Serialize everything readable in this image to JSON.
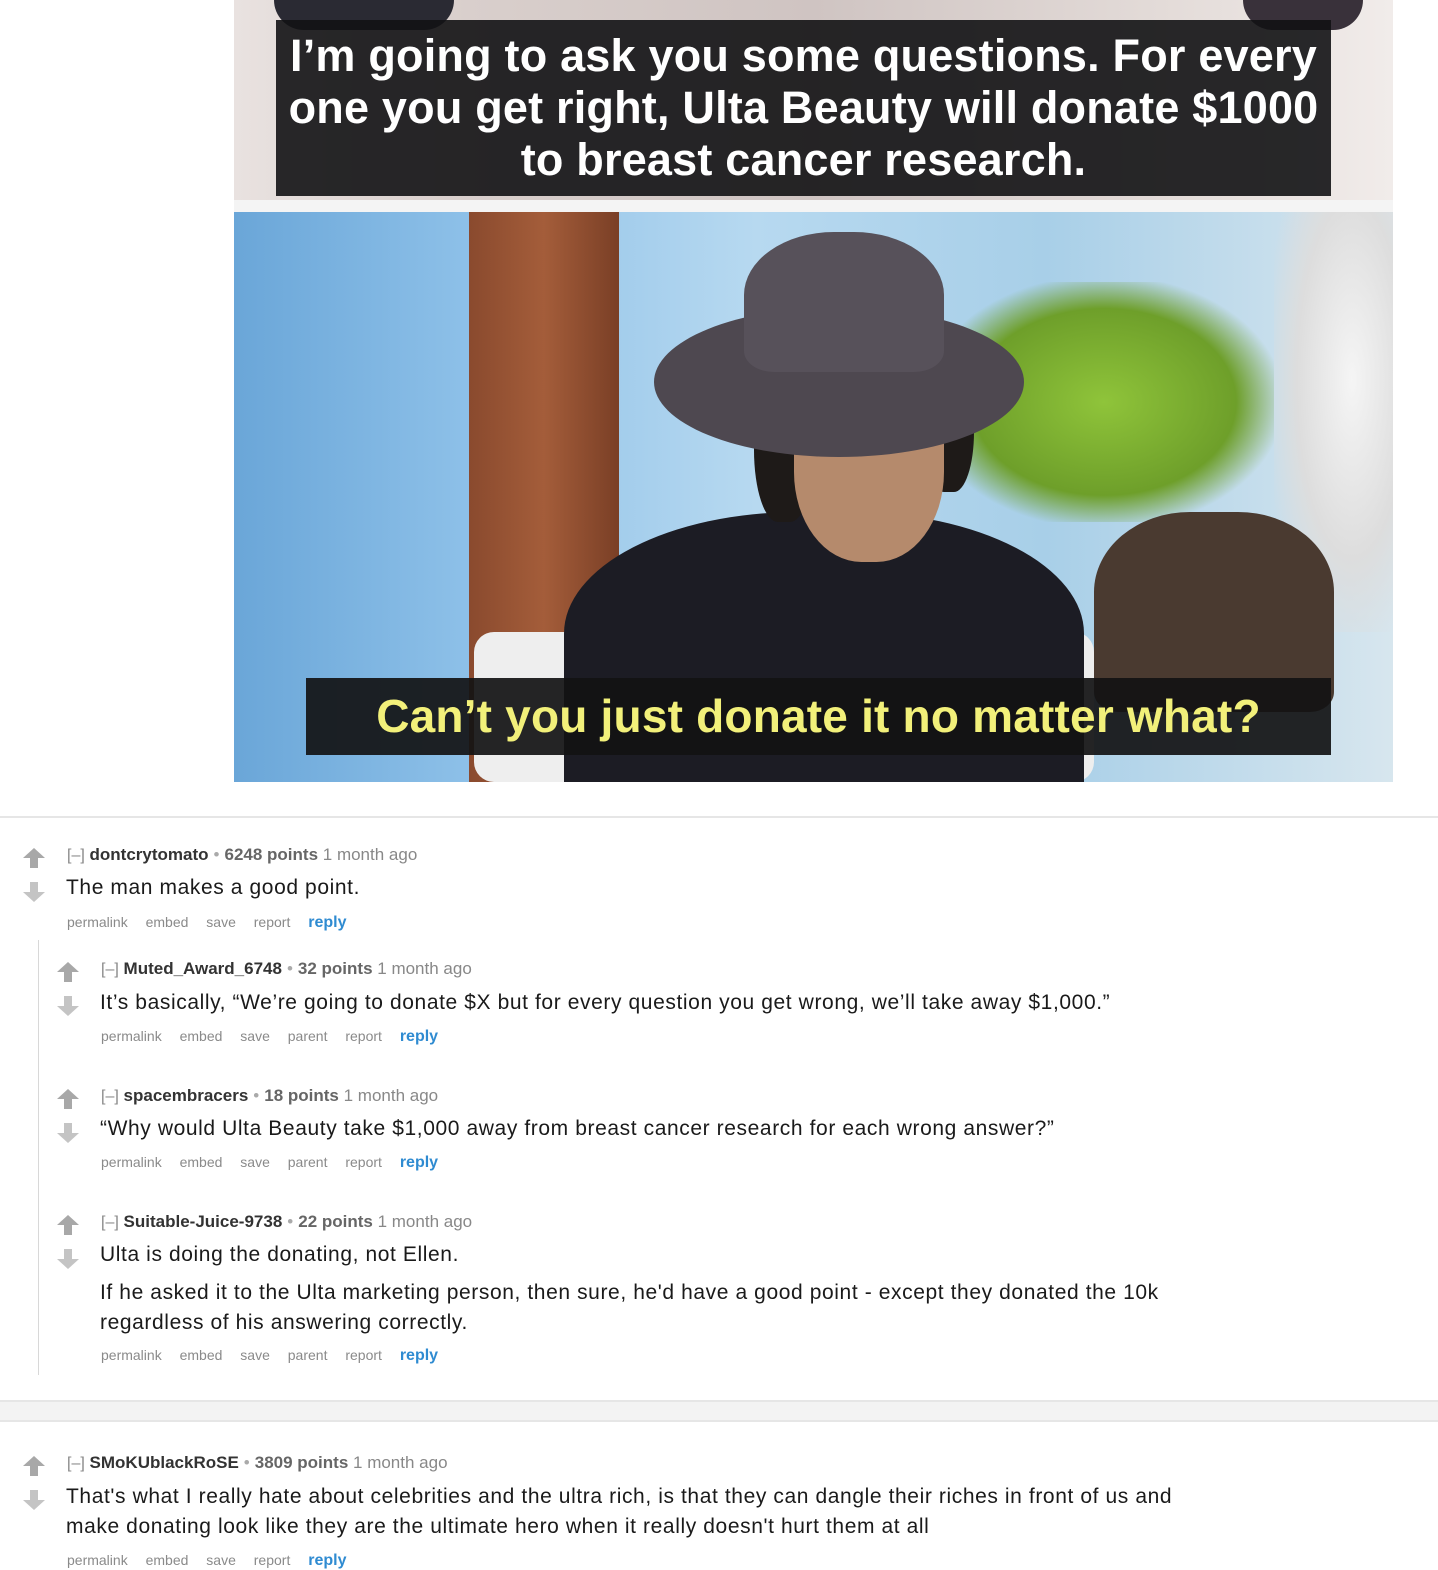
{
  "meme": {
    "caption_top": "I’m going to ask you some questions. For every one you get right, Ulta Beauty will donate $1000 to breast cancer research.",
    "caption_bottom": "Can’t you just donate it no matter what?"
  },
  "colors": {
    "reply_link": "#2f8bd1",
    "author": "#333333",
    "caption_bottom_text": "#f2f07a"
  },
  "icons": {
    "upvote": "up-arrow-icon",
    "downvote": "down-arrow-icon"
  },
  "comments": [
    {
      "collapse": "[–]",
      "author": "dontcrytomato",
      "score": "6248 points",
      "age": "1 month ago",
      "body": [
        "The man makes a good point."
      ],
      "buttons": [
        "permalink",
        "embed",
        "save",
        "report"
      ],
      "reply": "reply"
    },
    {
      "collapse": "[–]",
      "author": "Muted_Award_6748",
      "score": "32 points",
      "age": "1 month ago",
      "body": [
        "It’s basically, “We’re going to donate $X but for every question you get wrong, we’ll take away $1,000.”"
      ],
      "buttons": [
        "permalink",
        "embed",
        "save",
        "parent",
        "report"
      ],
      "reply": "reply"
    },
    {
      "collapse": "[–]",
      "author": "spacembracers",
      "score": "18 points",
      "age": "1 month ago",
      "body": [
        "“Why would Ulta Beauty take $1,000 away from breast cancer research for each wrong answer?”"
      ],
      "buttons": [
        "permalink",
        "embed",
        "save",
        "parent",
        "report"
      ],
      "reply": "reply"
    },
    {
      "collapse": "[–]",
      "author": "Suitable-Juice-9738",
      "score": "22 points",
      "age": "1 month ago",
      "body": [
        "Ulta is doing the donating, not Ellen.",
        "If he asked it to the Ulta marketing person, then sure, he'd have a good point - except they donated the 10k",
        "regardless of his answering correctly."
      ],
      "buttons": [
        "permalink",
        "embed",
        "save",
        "parent",
        "report"
      ],
      "reply": "reply"
    },
    {
      "collapse": "[–]",
      "author": "SMoKUblackRoSE",
      "score": "3809 points",
      "age": "1 month ago",
      "body": [
        "That's what I really hate about celebrities and the ultra rich, is that they can dangle their riches in front of us and",
        "make donating look like they are the ultimate hero when it really doesn't hurt them at all"
      ],
      "buttons": [
        "permalink",
        "embed",
        "save",
        "report"
      ],
      "reply": "reply"
    }
  ]
}
